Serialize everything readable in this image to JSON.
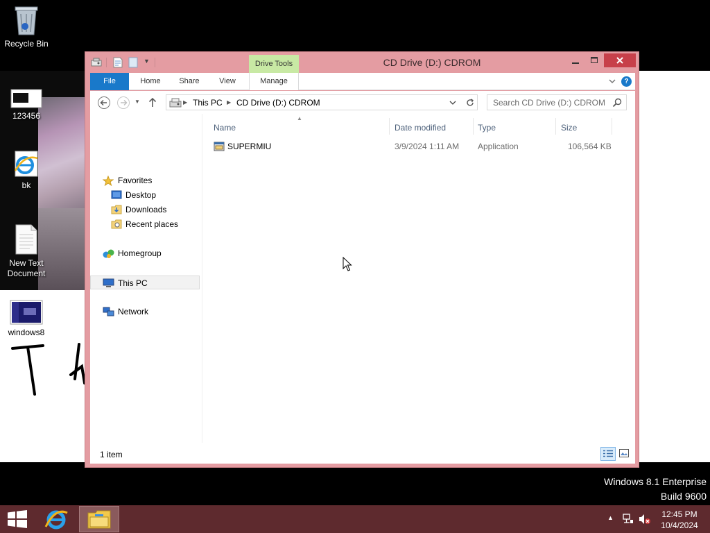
{
  "desktop": {
    "icons": [
      {
        "label": "Recycle Bin",
        "icon": "recycle-bin-icon"
      },
      {
        "label": "123456",
        "icon": "image-file-icon"
      },
      {
        "label": "bk",
        "icon": "internet-explorer-icon"
      },
      {
        "label": "New Text Document",
        "icon": "text-document-icon"
      },
      {
        "label": "windows8",
        "icon": "screenshot-image-icon"
      }
    ],
    "watermark_line1": "Windows 8.1 Enterprise",
    "watermark_line2": "Build 9600"
  },
  "window": {
    "title": "CD Drive (D:) CDROM",
    "contextual_tab_group": "Drive Tools",
    "ribbon_tabs": [
      "File",
      "Home",
      "Share",
      "View",
      "Manage"
    ],
    "accent": "#1979ca",
    "frame_color": "#e49ca2"
  },
  "address_bar": {
    "crumbs": [
      "This PC",
      "CD Drive (D:) CDROM"
    ],
    "search_placeholder": "Search CD Drive (D:) CDROM"
  },
  "nav_pane": {
    "favorites_label": "Favorites",
    "favorites": [
      "Desktop",
      "Downloads",
      "Recent places"
    ],
    "homegroup": "Homegroup",
    "this_pc": "This PC",
    "network": "Network"
  },
  "file_list": {
    "columns": [
      "Name",
      "Date modified",
      "Type",
      "Size"
    ],
    "rows": [
      {
        "name": "SUPERMIU",
        "date_modified": "3/9/2024 1:11 AM",
        "type": "Application",
        "size": "106,564 KB"
      }
    ]
  },
  "status_bar": {
    "item_count": "1 item"
  },
  "taskbar": {
    "clock_time": "12:45 PM",
    "clock_date": "10/4/2024",
    "color": "#5e2a2e"
  }
}
